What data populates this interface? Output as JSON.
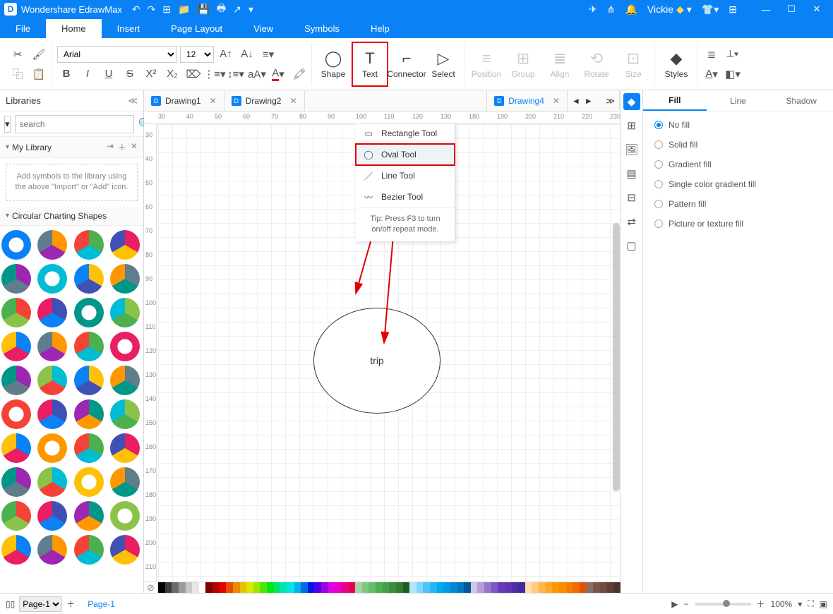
{
  "titlebar": {
    "app": "Wondershare EdrawMax",
    "user": "Vickie"
  },
  "menus": [
    "File",
    "Home",
    "Insert",
    "Page Layout",
    "View",
    "Symbols",
    "Help"
  ],
  "menu_active": 1,
  "font": {
    "family": "Arial",
    "size": "12"
  },
  "ribbon_big": [
    {
      "id": "shape",
      "label": "Shape",
      "ic": "◯"
    },
    {
      "id": "text",
      "label": "Text",
      "ic": "T"
    },
    {
      "id": "connector",
      "label": "Connector",
      "ic": "⌐"
    },
    {
      "id": "select",
      "label": "Select",
      "ic": "▷"
    },
    {
      "id": "position",
      "label": "Position",
      "ic": "≡",
      "d": true
    },
    {
      "id": "group",
      "label": "Group",
      "ic": "⊞",
      "d": true
    },
    {
      "id": "align",
      "label": "Align",
      "ic": "≣",
      "d": true
    },
    {
      "id": "rotate",
      "label": "Rotate",
      "ic": "⟲",
      "d": true
    },
    {
      "id": "size",
      "label": "Size",
      "ic": "⊡",
      "d": true
    },
    {
      "id": "styles",
      "label": "Styles",
      "ic": "◆"
    }
  ],
  "lib": {
    "title": "Libraries",
    "search_ph": "search",
    "mylib": "My Library",
    "note": "Add symbols to the library using the above \"Import\" or \"Add\" icon.",
    "sec2": "Circular Charting Shapes"
  },
  "doctabs": [
    "Drawing1",
    "Drawing2",
    "",
    "Drawing4"
  ],
  "doctab_active": 3,
  "shape_menu": {
    "items": [
      "Rectangle Tool",
      "Oval Tool",
      "Line Tool",
      "Bezier Tool"
    ],
    "sel": 1,
    "tip": "Tip: Press F3 to turn on/off repeat mode."
  },
  "oval_text": "trip",
  "fill": {
    "tabs": [
      "Fill",
      "Line",
      "Shadow"
    ],
    "active": 0,
    "opts": [
      "No fill",
      "Solid fill",
      "Gradient fill",
      "Single color gradient fill",
      "Pattern fill",
      "Picture or texture fill"
    ],
    "sel": 0
  },
  "page": {
    "sel": "Page-1",
    "label": "Page-1",
    "zoom": "100%"
  },
  "ruler_h": [
    30,
    40,
    50,
    60,
    70,
    80,
    90,
    100,
    110,
    120,
    130,
    180,
    190,
    200,
    210,
    220,
    230
  ],
  "ruler_v": [
    30,
    40,
    50,
    60,
    70,
    80,
    90,
    100,
    110,
    120,
    130,
    140,
    150,
    160,
    170,
    180,
    190,
    200,
    210
  ],
  "palette": [
    "#000",
    "#3b3b3b",
    "#6b6b6b",
    "#9b9b9b",
    "#c8c8c8",
    "#e6e6e6",
    "#fff",
    "#7c0000",
    "#b30000",
    "#e60000",
    "#e64d00",
    "#e68a00",
    "#e6c100",
    "#dfe600",
    "#9de600",
    "#4de600",
    "#00e615",
    "#00e66b",
    "#00e6b3",
    "#00e6e6",
    "#00b3e6",
    "#006be6",
    "#0015e6",
    "#4d00e6",
    "#9d00e6",
    "#df00e6",
    "#e600c1",
    "#e6008a",
    "#e6004d",
    "#a5d6a7",
    "#81c784",
    "#66bb6a",
    "#4caf50",
    "#43a047",
    "#388e3c",
    "#2e7d32",
    "#1b5e20",
    "#b3e5fc",
    "#81d4fa",
    "#4fc3f7",
    "#29b6f6",
    "#03a9f4",
    "#039be5",
    "#0288d1",
    "#0277bd",
    "#01579b",
    "#d1c4e9",
    "#b39ddb",
    "#9575cd",
    "#7e57c2",
    "#673ab7",
    "#5e35b1",
    "#512da8",
    "#4527a0",
    "#ffe0b2",
    "#ffcc80",
    "#ffb74d",
    "#ffa726",
    "#ff9800",
    "#fb8c00",
    "#f57c00",
    "#ef6c00",
    "#e65100",
    "#8d6e63",
    "#795548",
    "#6d4c41",
    "#5d4037",
    "#4e342e"
  ]
}
